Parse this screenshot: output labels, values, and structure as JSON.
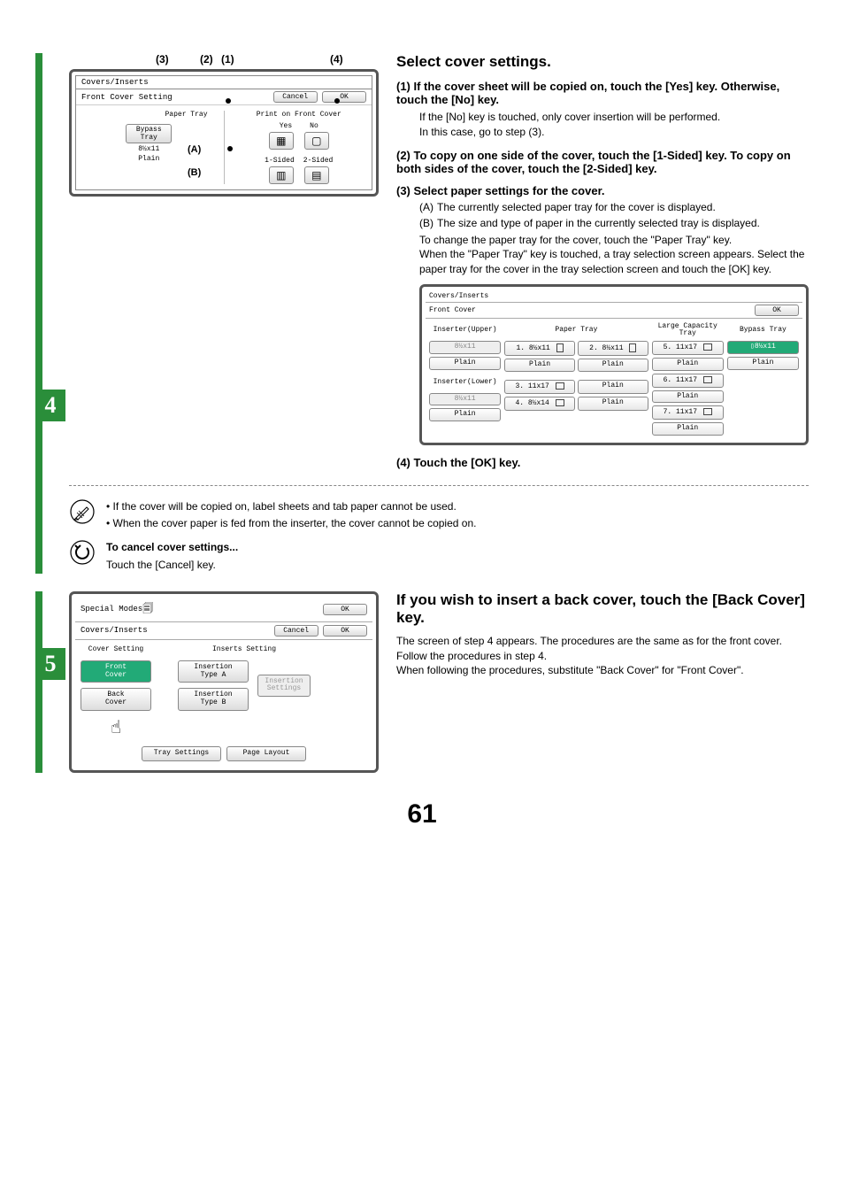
{
  "step4": {
    "num": "4",
    "markers": {
      "m1": "(1)",
      "m2": "(2)",
      "m3": "(3)",
      "m4": "(4)",
      "a": "(A)",
      "b": "(B)"
    },
    "panel1": {
      "title": "Covers/Inserts",
      "subtitle": "Front Cover Setting",
      "cancel": "Cancel",
      "ok": "OK",
      "paperTray": "Paper Tray",
      "bypassTray": "Bypass\nTray",
      "sizeLine": "8½x11",
      "typeLine": "Plain",
      "printOn": "Print on Front Cover",
      "yes": "Yes",
      "no": "No",
      "oneSided": "1-Sided",
      "twoSided": "2-Sided"
    },
    "heading": "Select cover settings.",
    "i1_h": "(1)  If the cover sheet will be copied on, touch the [Yes] key. Otherwise, touch the [No] key.",
    "i1_p1": "If the [No] key is touched, only cover insertion will be performed.",
    "i1_p2": "In this case, go to step (3).",
    "i2_h": "(2)  To copy on one side of the cover, touch the [1-Sided] key. To copy on both sides of the cover, touch the [2-Sided] key.",
    "i3_h": "(3)  Select paper settings for the cover.",
    "i3_a_lbl": "(A)",
    "i3_a": "The currently selected paper tray for the cover is displayed.",
    "i3_b_lbl": "(B)",
    "i3_b": "The size and type of paper in the currently selected tray is displayed.",
    "i3_p1": "To change the paper tray for the cover, touch the \"Paper Tray\" key.",
    "i3_p2": "When the \"Paper Tray\" key is touched, a tray selection screen appears. Select the paper tray for the cover in the tray selection screen and touch the [OK] key.",
    "trayPanel": {
      "title": "Covers/Inserts",
      "subtitle": "Front Cover",
      "ok": "OK",
      "col1": "Inserter(Upper)",
      "col1a": "8½x11",
      "col1b": "Plain",
      "col1c": "Inserter(Lower)",
      "col1d": "8½x11",
      "col1e": "Plain",
      "col2": "Paper Tray",
      "c2_1": "1. 8½x11",
      "c2_2": "2. 8½x11",
      "c2_1b": "Plain",
      "c2_2b": "Plain",
      "c2_3": "3. 11x17",
      "c2_3b": "Plain",
      "c2_4": "4. 8½x14",
      "c2_4b": "Plain",
      "col3": "Large Capacity Tray",
      "c3_5": "5. 11x17",
      "c3_5b": "Plain",
      "c3_6": "6. 11x17",
      "c3_6b": "Plain",
      "c3_7": "7. 11x17",
      "c3_7b": "Plain",
      "col4": "Bypass Tray",
      "c4_1": "8½x11",
      "c4_2": "Plain"
    },
    "i4_h": "(4)  Touch the [OK] key.",
    "note1": "If the cover will be copied on, label sheets and tab paper cannot be used.",
    "note2": "When the cover paper is fed from the inserter, the cover cannot be copied on.",
    "cancel_h": "To cancel cover settings...",
    "cancel_p": "Touch the [Cancel] key."
  },
  "step5": {
    "num": "5",
    "panel": {
      "specialModes": "Special Modes",
      "ok": "OK",
      "title": "Covers/Inserts",
      "cancel": "Cancel",
      "ok2": "OK",
      "coverSetting": "Cover Setting",
      "insertsSetting": "Inserts Setting",
      "frontCover": "Front\nCover",
      "backCover": "Back\nCover",
      "insA": "Insertion\nType A",
      "insB": "Insertion\nType B",
      "insSettings": "Insertion\nSettings",
      "traySettings": "Tray Settings",
      "pageLayout": "Page Layout"
    },
    "heading": "If you wish to insert a back cover, touch the [Back Cover] key.",
    "p1": "The screen of step 4 appears. The procedures are the same as for the front cover. Follow the procedures in step 4.",
    "p2": "When following the procedures, substitute \"Back Cover\" for \"Front Cover\"."
  },
  "pageNumber": "61"
}
